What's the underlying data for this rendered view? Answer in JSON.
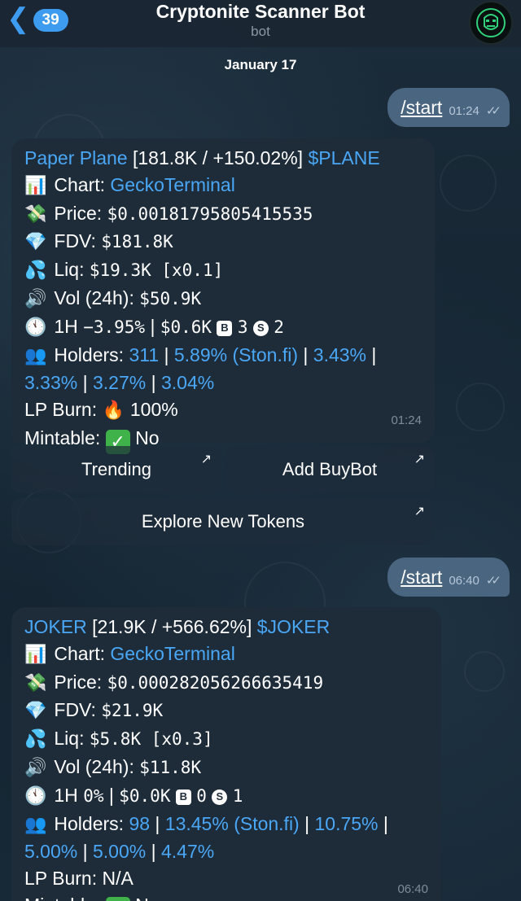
{
  "header": {
    "back_count": "39",
    "title": "Cryptonite Scanner Bot",
    "subtitle": "bot"
  },
  "date": "January 17",
  "messages": {
    "out1": {
      "text": "/start",
      "time": "01:24"
    },
    "card1": {
      "name": "Paper Plane",
      "stats": "[181.8K / +150.02%]",
      "ticker": "$PLANE",
      "chart_label": "Chart:",
      "chart_link": "GeckoTerminal",
      "price_label": "Price:",
      "price": "$0.00181795805415535",
      "fdv_label": "FDV:",
      "fdv": "$181.8K",
      "liq_label": "Liq:",
      "liq": "$19.3K [x0.1]",
      "vol_label": "Vol (24h):",
      "vol": "$50.9K",
      "h1_label": "1H",
      "h1_change": "−3.95%",
      "h1_sep": "|",
      "h1_amount": "$0.6K",
      "buys": "3",
      "sells": "2",
      "holders_label": "Holders:",
      "holders_count": "311",
      "holders_top": [
        "5.89% (Ston.fi)",
        "3.43%",
        "3.33%",
        "3.27%",
        "3.04%"
      ],
      "lp_label": "LP Burn:",
      "lp_value": "100%",
      "mint_label": "Mintable:",
      "mint_value": "No",
      "time": "01:24"
    },
    "buttons1": {
      "trending": "Trending",
      "add_buybot": "Add BuyBot",
      "explore": "Explore New Tokens"
    },
    "out2": {
      "text": "/start",
      "time": "06:40"
    },
    "card2": {
      "name": "JOKER",
      "stats": "[21.9K / +566.62%]",
      "ticker": "$JOKER",
      "chart_label": "Chart:",
      "chart_link": "GeckoTerminal",
      "price_label": "Price:",
      "price": "$0.000282056266635419",
      "fdv_label": "FDV:",
      "fdv": "$21.9K",
      "liq_label": "Liq:",
      "liq": "$5.8K [x0.3]",
      "vol_label": "Vol (24h):",
      "vol": "$11.8K",
      "h1_label": "1H",
      "h1_change": "0%",
      "h1_sep": "|",
      "h1_amount": "$0.0K",
      "buys": "0",
      "sells": "1",
      "holders_label": "Holders:",
      "holders_count": "98",
      "holders_top": [
        "13.45% (Ston.fi)",
        "10.75%",
        "5.00%",
        "5.00%",
        "4.47%"
      ],
      "lp_label": "LP Burn:",
      "lp_value": "N/A",
      "mint_label": "Mintable:",
      "mint_value": "No",
      "time": "06:40"
    }
  },
  "colors": {
    "accent": "#4aa7f5",
    "bubble_in": "#1e2c3a",
    "bubble_out": "#4a6580",
    "check": "#3fb24a"
  },
  "icons": {
    "chart": "bar-chart-icon",
    "price": "money-wings-icon",
    "fdv": "gem-icon",
    "liq": "droplets-icon",
    "vol": "speaker-icon",
    "h1": "clock-icon",
    "holders": "people-icon",
    "lp": "fire-icon",
    "mint": "check-mark-icon"
  }
}
